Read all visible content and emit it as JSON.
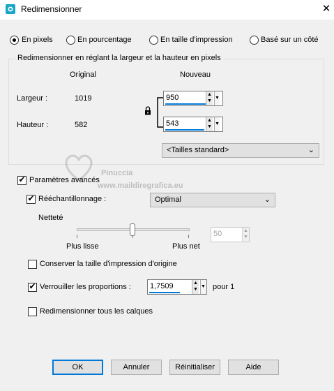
{
  "window": {
    "title": "Redimensionner",
    "close_glyph": "✕"
  },
  "modes": {
    "pixels": "En pixels",
    "percent": "En pourcentage",
    "print_size": "En taille d'impression",
    "one_side": "Basé sur un côté",
    "selected": "pixels"
  },
  "size_group": {
    "title": "Redimensionner en réglant la largeur et la hauteur en pixels",
    "col_original": "Original",
    "col_new": "Nouveau",
    "width_label": "Largeur :",
    "height_label": "Hauteur :",
    "width_original": "1019",
    "height_original": "582",
    "width_new": "950",
    "height_new": "543",
    "standard_sizes": "<Tailles standard>",
    "lock_icon": "padlock-icon"
  },
  "advanced": {
    "label": "Paramètres avancés",
    "checked": true,
    "resample_label": "Rééchantillonnage :",
    "resample_checked": true,
    "resample_value": "Optimal",
    "sharpness_label": "Netteté",
    "smoother_label": "Plus lisse",
    "sharper_label": "Plus net",
    "sharpness_value": "50",
    "sharpness_level_percent": 50,
    "keep_print_size": "Conserver la taille d'impression d'origine",
    "keep_print_checked": false,
    "lock_ratio": "Verrouiller les proportions :",
    "lock_ratio_checked": true,
    "ratio_value": "1,7509",
    "ratio_suffix": "pour 1",
    "resize_all_layers": "Redimensionner tous les calques",
    "resize_all_checked": false
  },
  "watermark": {
    "line1": "Pinuccia",
    "line2": "www.maildiregrafica.eu"
  },
  "buttons": {
    "ok": "OK",
    "cancel": "Annuler",
    "reset": "Réinitialiser",
    "help": "Aide"
  },
  "colors": {
    "accent": "#0078d7",
    "client_bg": "#f0f0f0"
  }
}
